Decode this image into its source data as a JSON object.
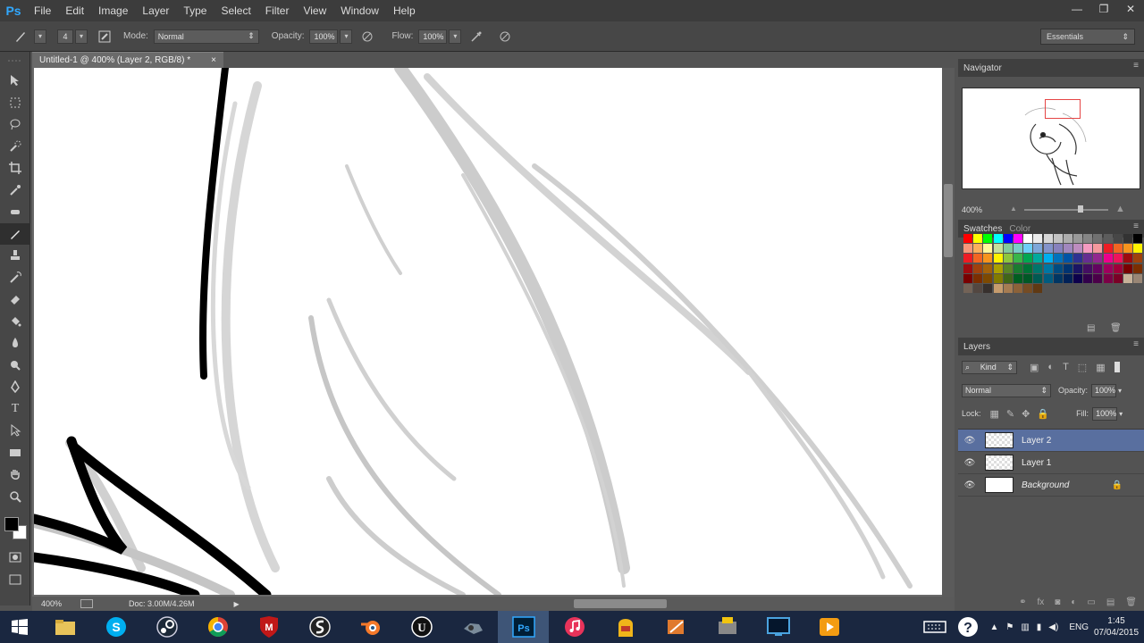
{
  "app": {
    "logo": "Ps"
  },
  "menu": [
    "File",
    "Edit",
    "Image",
    "Layer",
    "Type",
    "Select",
    "Filter",
    "View",
    "Window",
    "Help"
  ],
  "window_controls": {
    "minimize": "—",
    "restore": "❐",
    "close": "✕"
  },
  "options_bar": {
    "brush_size": "4",
    "mode_label": "Mode:",
    "mode_value": "Normal",
    "opacity_label": "Opacity:",
    "opacity_value": "100%",
    "flow_label": "Flow:",
    "flow_value": "100%",
    "workspace": "Essentials"
  },
  "document": {
    "tab_title": "Untitled-1 @ 400% (Layer 2, RGB/8) *",
    "tab_close": "×",
    "status_zoom": "400%",
    "status_doc": "Doc: 3.00M/4.26M"
  },
  "navigator": {
    "title": "Navigator",
    "zoom": "400%"
  },
  "swatches": {
    "tab_swatches": "Swatches",
    "tab_color": "Color"
  },
  "layers_panel": {
    "title": "Layers",
    "filter_kind": "Kind",
    "blend_mode": "Normal",
    "opacity_label": "Opacity:",
    "opacity_value": "100%",
    "lock_label": "Lock:",
    "fill_label": "Fill:",
    "fill_value": "100%",
    "layers": [
      {
        "name": "Layer 2",
        "selected": true
      },
      {
        "name": "Layer 1",
        "selected": false
      },
      {
        "name": "Background",
        "selected": false
      }
    ]
  },
  "taskbar": {
    "language": "ENG",
    "time": "1:45",
    "date": "07/04/2015"
  },
  "colors": {
    "swatch_rows": [
      [
        "#ff0000",
        "#ffff00",
        "#00ff00",
        "#00ffff",
        "#0000ff",
        "#ff00ff",
        "#ffffff",
        "#ebebeb",
        "#d6d6d6",
        "#c2c2c2",
        "#adadad",
        "#999999",
        "#858585",
        "#707070",
        "#5c5c5c",
        "#474747",
        "#333333",
        "#000000"
      ],
      [
        "#f7977a",
        "#fbaf5d",
        "#fff79a",
        "#c4df9b",
        "#82ca9c",
        "#7accc8",
        "#6dcff6",
        "#7da7d9",
        "#8393ca",
        "#8781bd",
        "#a187be",
        "#bd8cbf",
        "#f49ac1",
        "#f5989d",
        "#ed1c24",
        "#f26522",
        "#f7941d",
        "#fff200"
      ],
      [
        "#ed1c24",
        "#f26522",
        "#f7941d",
        "#fff200",
        "#8dc63f",
        "#39b54a",
        "#00a651",
        "#00a99d",
        "#00aeef",
        "#0072bc",
        "#0054a6",
        "#2e3192",
        "#662d91",
        "#92278f",
        "#ec008c",
        "#ed145b",
        "#9e0b0f",
        "#a0410d"
      ],
      [
        "#9e0b0f",
        "#a0410d",
        "#a3620a",
        "#aba000",
        "#598527",
        "#1a7b30",
        "#007236",
        "#00746b",
        "#0076a3",
        "#004b80",
        "#003471",
        "#1b1464",
        "#440e62",
        "#630460",
        "#9e005d",
        "#9e0039",
        "#790000",
        "#7b2e00"
      ],
      [
        "#790000",
        "#7b2e00",
        "#7d4900",
        "#827b00",
        "#406618",
        "#005e20",
        "#005826",
        "#005952",
        "#005b7f",
        "#003663",
        "#002157",
        "#0d004c",
        "#32004b",
        "#4b0049",
        "#7b0046",
        "#7a0026",
        "#c7b299",
        "#998675"
      ],
      [
        "#736357",
        "#534741",
        "#37302d",
        "#c69c6d",
        "#a67c52",
        "#8c6239",
        "#754c24",
        "#603913"
      ]
    ]
  }
}
